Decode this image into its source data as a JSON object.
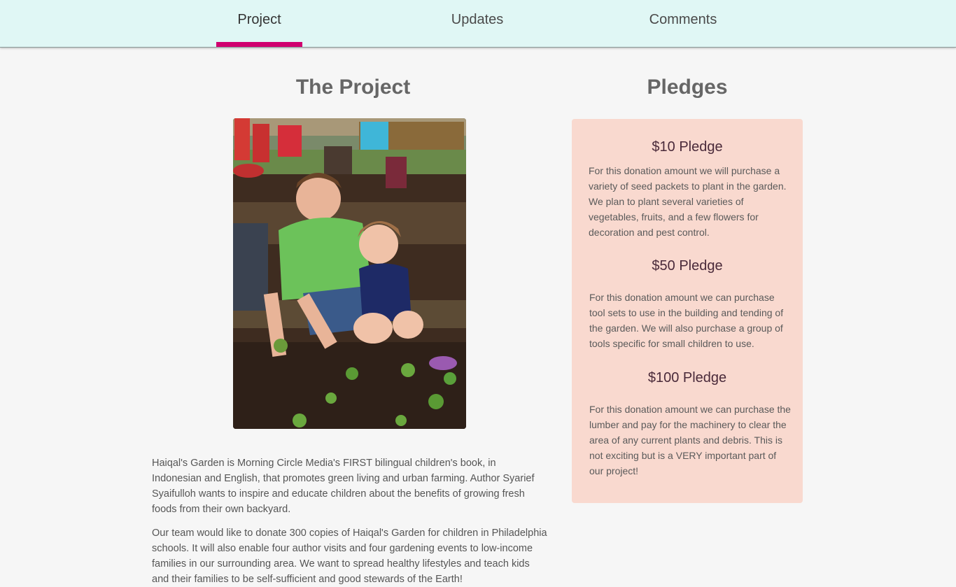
{
  "nav": {
    "tabs": [
      {
        "label": "Project",
        "active": true
      },
      {
        "label": "Updates",
        "active": false
      },
      {
        "label": "Comments",
        "active": false
      }
    ],
    "accent_color": "#d0006f"
  },
  "project": {
    "title": "The Project",
    "paragraphs": [
      "Haiqal's Garden is Morning Circle Media's FIRST bilingual children's book, in Indonesian and English, that promotes green living and urban farming. Author Syarief Syaifulloh wants to inspire and educate children about the benefits of growing fresh foods from their own backyard.",
      "Our team would like to donate 300 copies of Haiqal's Garden for children in Philadelphia schools. It will also enable four author visits and four gardening events to low-income families in our surrounding area. We want to spread healthy lifestyles and teach kids and their families to be self-sufficient and good stewards of the Earth!"
    ]
  },
  "pledges": {
    "title": "Pledges",
    "box_color": "#f9d9cf",
    "items": [
      {
        "title": "$10 Pledge",
        "text": "For this donation amount we will purchase a variety of seed packets to plant in the garden. We plan to plant several varieties of vegetables, fruits, and a few flowers for decoration and pest control."
      },
      {
        "title": "$50 Pledge",
        "text": "For this donation amount we can purchase tool sets to use in the building and tending of the garden. We will also purchase a group of tools specific for small children to use."
      },
      {
        "title": "$100 Pledge",
        "text": "For this donation amount we can purchase the lumber and pay for the machinery to clear the area of any current plants and debris. This is not exciting but is a VERY important part of our project!"
      }
    ]
  }
}
